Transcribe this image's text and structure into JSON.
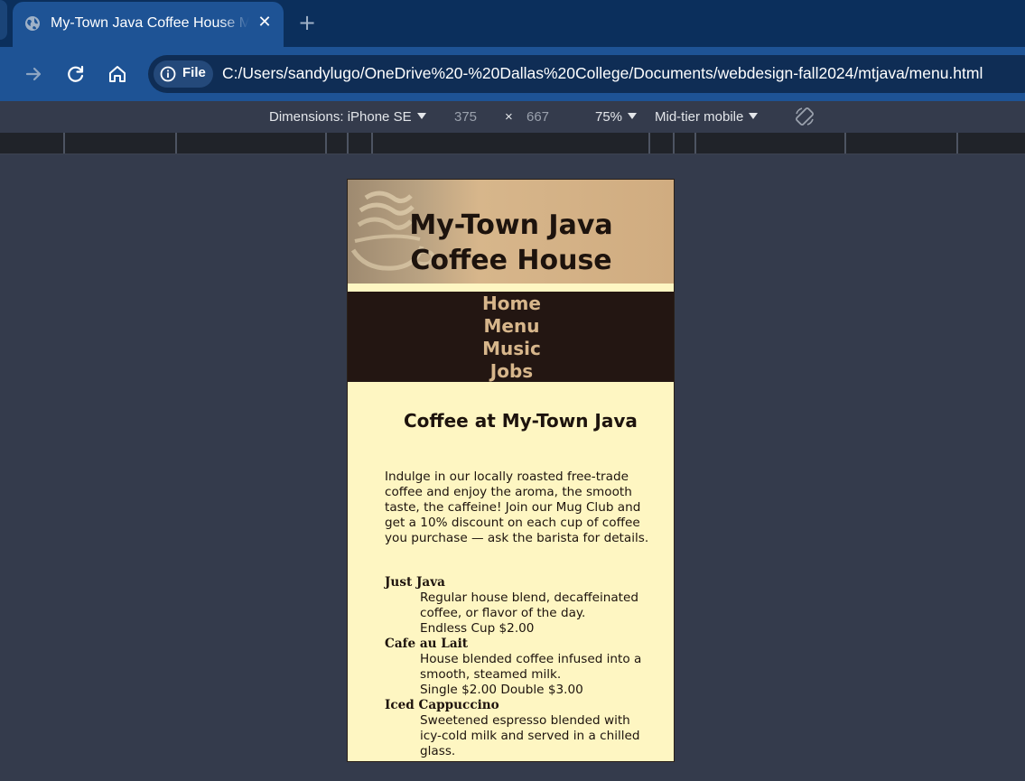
{
  "browser": {
    "tab_title": "My-Town Java Coffee House Menu",
    "security_chip_label": "File",
    "url": "C:/Users/sandylugo/OneDrive%20-%20Dallas%20College/Documents/webdesign-fall2024/mtjava/menu.html"
  },
  "device_toolbar": {
    "dimensions_label": "Dimensions: iPhone SE",
    "width": "375",
    "times": "×",
    "height": "667",
    "zoom": "75%",
    "throttling": "Mid-tier mobile"
  },
  "site": {
    "title": "My-Town Java Coffee House",
    "nav": [
      "Home",
      "Menu",
      "Music",
      "Jobs"
    ],
    "heading": "Coffee at My-Town Java",
    "intro": "Indulge in our locally roasted free-trade coffee and enjoy the aroma, the smooth taste, the caffeine! Join our Mug Club and get a 10% discount on each cup of coffee you purchase — ask the barista for details.",
    "menu": [
      {
        "name": "Just Java",
        "description": "Regular house blend, decaffeinated coffee, or flavor of the day.",
        "price": "Endless Cup $2.00"
      },
      {
        "name": "Cafe au Lait",
        "description": "House blended coffee infused into a smooth, steamed milk.",
        "price": "Single $2.00 Double $3.00"
      },
      {
        "name": "Iced Cappuccino",
        "description": "Sweetened espresso blended with icy-cold milk and served in a chilled glass.",
        "price": ""
      }
    ]
  },
  "colors": {
    "nav_background": "#231612",
    "nav_link": "#d7b68b",
    "page_background": "#fef6c2",
    "header_tan": "#d0ac80"
  }
}
